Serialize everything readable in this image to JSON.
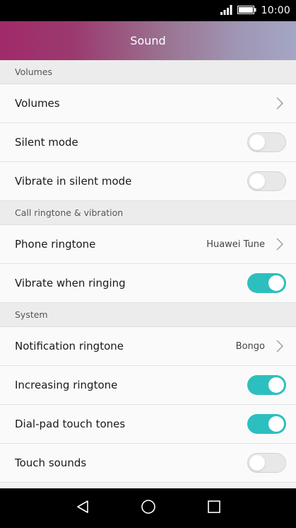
{
  "status_bar": {
    "time": "10:00",
    "icons": [
      "signal-icon",
      "battery-icon"
    ]
  },
  "header": {
    "title": "Sound",
    "gradient": [
      "#a12a6a",
      "#a3a6c4"
    ]
  },
  "sections": [
    {
      "title": "Volumes",
      "rows": [
        {
          "label": "Volumes",
          "type": "link",
          "value": ""
        }
      ]
    },
    {
      "title": "",
      "rows": [
        {
          "label": "Silent mode",
          "type": "toggle",
          "checked": false
        },
        {
          "label": "Vibrate in silent mode",
          "type": "toggle",
          "checked": false
        }
      ]
    },
    {
      "title": "Call ringtone & vibration",
      "rows": [
        {
          "label": "Phone ringtone",
          "type": "link",
          "value": "Huawei Tune"
        },
        {
          "label": "Vibrate when ringing",
          "type": "toggle",
          "checked": true
        }
      ]
    },
    {
      "title": "System",
      "rows": [
        {
          "label": "Notification ringtone",
          "type": "link",
          "value": "Bongo"
        },
        {
          "label": "Increasing ringtone",
          "type": "toggle",
          "checked": true
        },
        {
          "label": "Dial-pad touch tones",
          "type": "toggle",
          "checked": true
        },
        {
          "label": "Touch sounds",
          "type": "toggle",
          "checked": false
        }
      ]
    }
  ],
  "colors": {
    "toggle_on": "#2dbfbf",
    "toggle_off": "#e8e8e8",
    "section_bg": "#ececec",
    "row_bg": "#fafafa"
  },
  "nav": {
    "buttons": [
      "back-icon",
      "home-icon",
      "recents-icon"
    ]
  }
}
